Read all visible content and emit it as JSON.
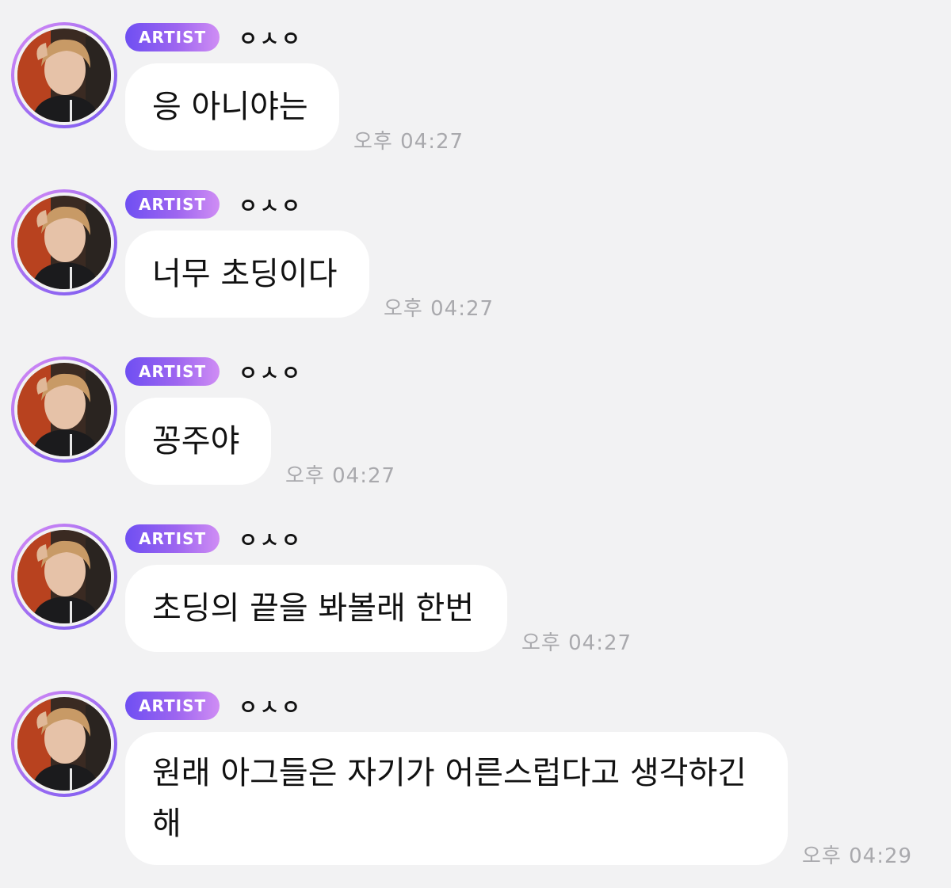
{
  "messages": [
    {
      "badge": "ARTIST",
      "nickname": "ㅇㅅㅇ",
      "avatar_icon": "artist-profile-photo",
      "text": "응 아니야는",
      "time": "오후 04:27"
    },
    {
      "badge": "ARTIST",
      "nickname": "ㅇㅅㅇ",
      "avatar_icon": "artist-profile-photo",
      "text": "너무 초딩이다",
      "time": "오후 04:27"
    },
    {
      "badge": "ARTIST",
      "nickname": "ㅇㅅㅇ",
      "avatar_icon": "artist-profile-photo",
      "text": "꽁주야",
      "time": "오후 04:27"
    },
    {
      "badge": "ARTIST",
      "nickname": "ㅇㅅㅇ",
      "avatar_icon": "artist-profile-photo",
      "text": "초딩의 끝을 봐볼래 한번",
      "time": "오후 04:27"
    },
    {
      "badge": "ARTIST",
      "nickname": "ㅇㅅㅇ",
      "avatar_icon": "artist-profile-photo",
      "text": "원래 아그들은 자기가 어른스럽다고 생각하긴\n해",
      "time": "오후 04:29"
    }
  ],
  "colors": {
    "background": "#f2f2f3",
    "bubble": "#ffffff",
    "badge_start": "#6f4ff2",
    "badge_end": "#cf8df4",
    "timestamp": "#a9a9ad"
  }
}
